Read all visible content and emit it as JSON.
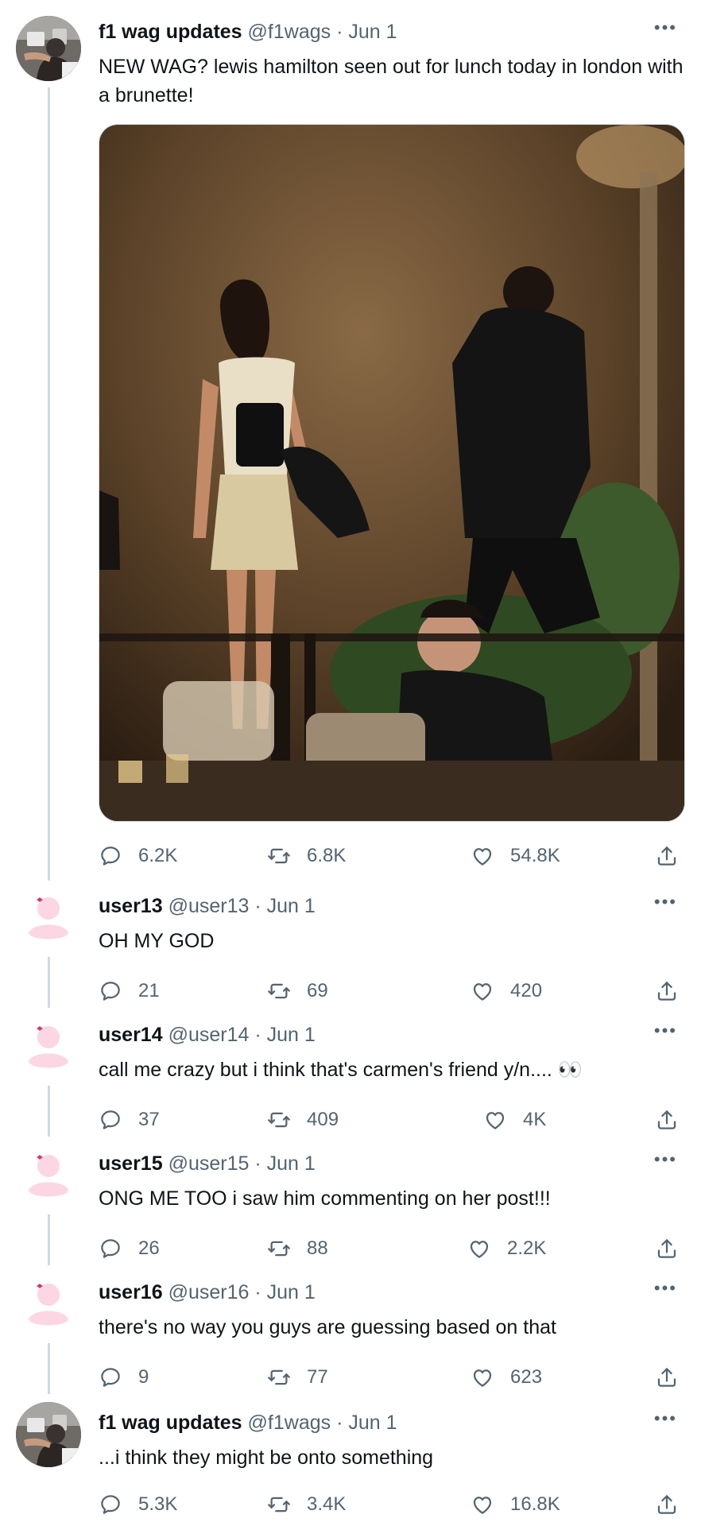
{
  "tweets": [
    {
      "display_name": "f1 wag updates",
      "handle": "@f1wags",
      "date": "Jun 1",
      "text": "NEW WAG? lewis hamilton seen out for lunch today in london with a brunette!",
      "replies": "6.2K",
      "retweets": "6.8K",
      "likes": "54.8K"
    },
    {
      "display_name": "user13",
      "handle": "@user13",
      "date": "Jun 1",
      "text": "OH MY GOD",
      "replies": "21",
      "retweets": "69",
      "likes": "420"
    },
    {
      "display_name": "user14",
      "handle": "@user14",
      "date": "Jun 1",
      "text": "call me crazy but i think that's carmen's friend y/n.... 👀",
      "replies": "37",
      "retweets": "409",
      "likes": "4K"
    },
    {
      "display_name": "user15",
      "handle": "@user15",
      "date": "Jun 1",
      "text": "ONG ME TOO i saw him commenting on her post!!!",
      "replies": "26",
      "retweets": "88",
      "likes": "2.2K"
    },
    {
      "display_name": "user16",
      "handle": "@user16",
      "date": "Jun 1",
      "text": "there's no way you guys are guessing based on that",
      "replies": "9",
      "retweets": "77",
      "likes": "623"
    },
    {
      "display_name": "f1 wag updates",
      "handle": "@f1wags",
      "date": "Jun 1",
      "text": "...i think they might be onto something",
      "replies": "5.3K",
      "retweets": "3.4K",
      "likes": "16.8K"
    }
  ],
  "separator": "·",
  "more_glyph": "•••",
  "icons": {
    "reply": "reply-icon",
    "retweet": "retweet-icon",
    "like": "heart-icon",
    "share": "share-icon",
    "more": "more-icon"
  },
  "colors": {
    "text_primary": "#0f1419",
    "text_secondary": "#536471",
    "thread_line": "#cfd9de",
    "default_avatar_pink": "#fcd6e3"
  }
}
